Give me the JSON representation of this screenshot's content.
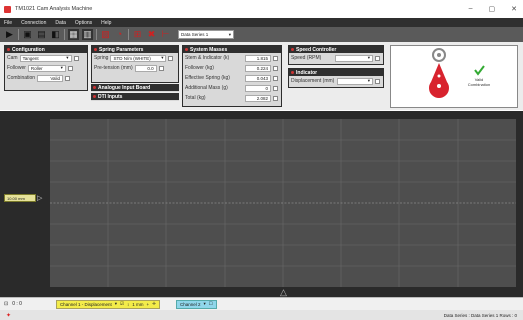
{
  "window": {
    "title": "TM1021 Cam Analysis Machine",
    "controls": [
      "–",
      "▢",
      "✕"
    ]
  },
  "menu": [
    "File",
    "Connection",
    "Data",
    "Options",
    "Help"
  ],
  "toolbar": {
    "series_value": "Data Series 1"
  },
  "configuration": {
    "title": "Configuration",
    "cam_label": "Cam",
    "cam_value": "Tangent",
    "follower_label": "Follower",
    "follower_value": "Roller",
    "combination_label": "Combination",
    "combination_value": "Valid"
  },
  "spring": {
    "title": "Spring Parameters",
    "spring_label": "Spring",
    "spring_value": "STD N/m (WHITE)",
    "pretension_label": "Pre-tension (mm)",
    "pretension_value": "0.0"
  },
  "analogue": {
    "title": "Analogue Input Board"
  },
  "dti": {
    "title": "DTI Inputs"
  },
  "system_masses": {
    "title": "System Masses",
    "rows": [
      {
        "label": "Stem & Indicator (k)",
        "value": "1.815"
      },
      {
        "label": "Follower (kg)",
        "value": "0.224"
      },
      {
        "label": "Effective Spring (kg)",
        "value": "0.043"
      },
      {
        "label": "Additional Mass (g)",
        "value": "0"
      },
      {
        "label": "Total (kg)",
        "value": "2.082"
      }
    ]
  },
  "speed": {
    "title": "Speed Controller",
    "label": "Speed (RPM)",
    "value": ""
  },
  "indicator": {
    "title": "Indicator",
    "label": "Displacement (mm)",
    "value": ""
  },
  "preview": {
    "status_line1": "Valid",
    "status_line2": "Combination"
  },
  "graph": {
    "marker_label": "10.00 mm"
  },
  "channels": {
    "counter": "0 : 0",
    "channel1": "Channel 1 - Displacement",
    "channel1_scale": "1 mm",
    "channel2": "Channel 2"
  },
  "status": {
    "right": "Data Series : Data Series 1  Rows : 0"
  }
}
